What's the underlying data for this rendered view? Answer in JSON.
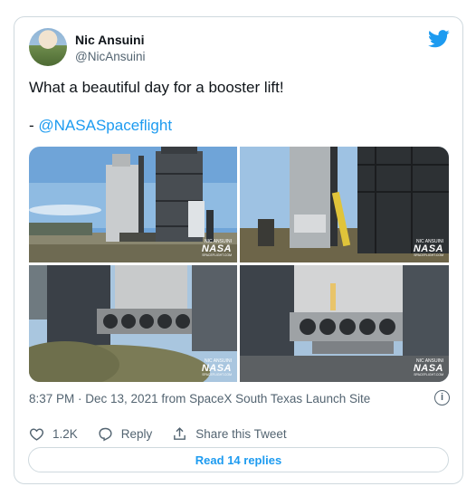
{
  "author": {
    "name": "Nic Ansuini",
    "handle": "@NicAnsuini"
  },
  "tweet": {
    "line1": "What a beautiful day for a booster lift!",
    "prefix": "- ",
    "mention": "@NASASpaceflight"
  },
  "watermark": {
    "small": "NIC ANSUINI",
    "large": "NASA",
    "sub": "SPACEFLIGHT.COM"
  },
  "meta": {
    "timestamp": "8:37 PM · Dec 13, 2021 from SpaceX South Texas Launch Site"
  },
  "actions": {
    "likes": "1.2K",
    "reply_label": "Reply",
    "share_label": "Share this Tweet"
  },
  "read_button": "Read 14 replies",
  "colors": {
    "accent": "#1d9bf0",
    "secondary_text": "#536471",
    "border": "#cfd9de"
  },
  "icons": [
    "twitter-bird-icon",
    "info-icon",
    "heart-icon",
    "reply-icon",
    "share-icon"
  ]
}
